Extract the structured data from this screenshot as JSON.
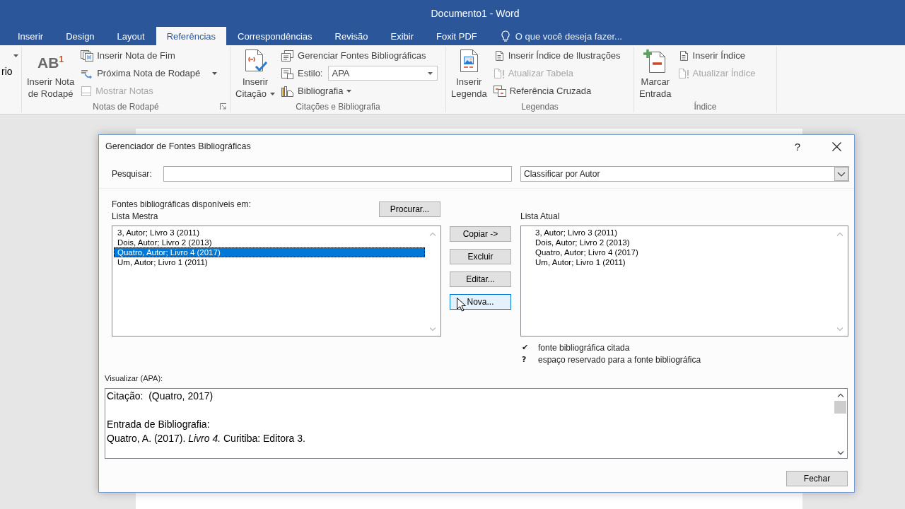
{
  "window": {
    "title": "Documento1 - Word"
  },
  "tabs": [
    {
      "label": "Inserir",
      "selected": false
    },
    {
      "label": "Design",
      "selected": false
    },
    {
      "label": "Layout",
      "selected": false
    },
    {
      "label": "Referências",
      "selected": true
    },
    {
      "label": "Correspondências",
      "selected": false
    },
    {
      "label": "Revisão",
      "selected": false
    },
    {
      "label": "Exibir",
      "selected": false
    },
    {
      "label": "Foxit PDF",
      "selected": false
    }
  ],
  "tell_me": {
    "label": "O que você deseja fazer..."
  },
  "ribbon": {
    "partial_group": {
      "label": "rio"
    },
    "groups": [
      {
        "label": "Notas de Rodapé",
        "launcher": true,
        "large": [
          {
            "lines": [
              "Inserir Nota",
              "de Rodapé"
            ],
            "glyph": "AB$^{1}$",
            "kind": "button"
          }
        ],
        "small": [
          {
            "label": "Inserir Nota de Fim",
            "kind": "button",
            "disabled": false
          },
          {
            "label": "Próxima Nota de Rodapé",
            "kind": "split_button",
            "disabled": false
          },
          {
            "label": "Mostrar Notas",
            "kind": "button",
            "disabled": true
          }
        ]
      },
      {
        "label": "Citações e Bibliografia",
        "launcher": false,
        "large": [
          {
            "lines": [
              "Inserir",
              "Citação"
            ],
            "kind": "menu_button"
          }
        ],
        "small": [
          {
            "label": "Gerenciar Fontes Bibliográficas",
            "kind": "button",
            "disabled": false
          },
          {
            "label": "Estilo:",
            "kind": "select",
            "value": "APA"
          },
          {
            "label": "Bibliografia",
            "kind": "menu_button",
            "disabled": false
          }
        ]
      },
      {
        "label": "Legendas",
        "launcher": false,
        "large": [
          {
            "lines": [
              "Inserir",
              "Legenda"
            ],
            "kind": "button"
          }
        ],
        "small": [
          {
            "label": "Inserir Índice de Ilustrações",
            "kind": "button",
            "disabled": false
          },
          {
            "label": "Atualizar Tabela",
            "kind": "button",
            "disabled": true
          },
          {
            "label": "Referência Cruzada",
            "kind": "button",
            "disabled": false
          }
        ]
      },
      {
        "label": "Índice",
        "launcher": false,
        "large": [
          {
            "lines": [
              "Marcar",
              "Entrada"
            ],
            "kind": "button"
          }
        ],
        "small": [
          {
            "label": "Inserir Índice",
            "kind": "button",
            "disabled": false
          },
          {
            "label": "Atualizar Índice",
            "kind": "button",
            "disabled": true
          }
        ]
      }
    ]
  },
  "dialog": {
    "title": "Gerenciador de Fontes Bibliográficas",
    "help": "?",
    "search": {
      "label": "Pesquisar:"
    },
    "sort": {
      "value": "Classificar por Autor"
    },
    "sources_label": "Fontes bibliográficas disponíveis em:",
    "browse_button": "Procurar...",
    "master": {
      "label": "Lista Mestra",
      "items": [
        {
          "text": "3, Autor; Livro 3 (2011)",
          "selected": false
        },
        {
          "text": "Dois, Autor; Livro 2 (2013)",
          "selected": false
        },
        {
          "text": "Quatro, Autor; Livro 4 (2017)",
          "selected": true
        },
        {
          "text": "Um, Autor; Livro 1 (2011)",
          "selected": false
        }
      ]
    },
    "actions": [
      {
        "label": "Copiar ->",
        "focused": false
      },
      {
        "label": "Excluir",
        "focused": false
      },
      {
        "label": "Editar...",
        "focused": false
      },
      {
        "label": "Nova...",
        "focused": true
      }
    ],
    "current": {
      "label": "Lista Atual",
      "items": [
        {
          "text": "3, Autor; Livro 3 (2011)",
          "selected": false
        },
        {
          "text": "Dois, Autor; Livro 2 (2013)",
          "selected": false
        },
        {
          "text": "Quatro, Autor; Livro 4 (2017)",
          "selected": false
        },
        {
          "text": "Um, Autor; Livro 1 (2011)",
          "selected": false
        }
      ]
    },
    "legend": [
      {
        "symbol": "✔",
        "text": "fonte bibliográfica citada"
      },
      {
        "symbol": "?",
        "text": "espaço reservado para a fonte bibliográfica"
      }
    ],
    "preview": {
      "label": "Visualizar (APA):",
      "paragraphs": [
        [
          "Citação:  (Quatro, 2017)"
        ],
        [
          "Entrada de Bibliografia:",
          "Quatro, A. (2017). *Livro 4.* Curitiba: Editora 3."
        ]
      ]
    },
    "close_button": "Fechar"
  }
}
